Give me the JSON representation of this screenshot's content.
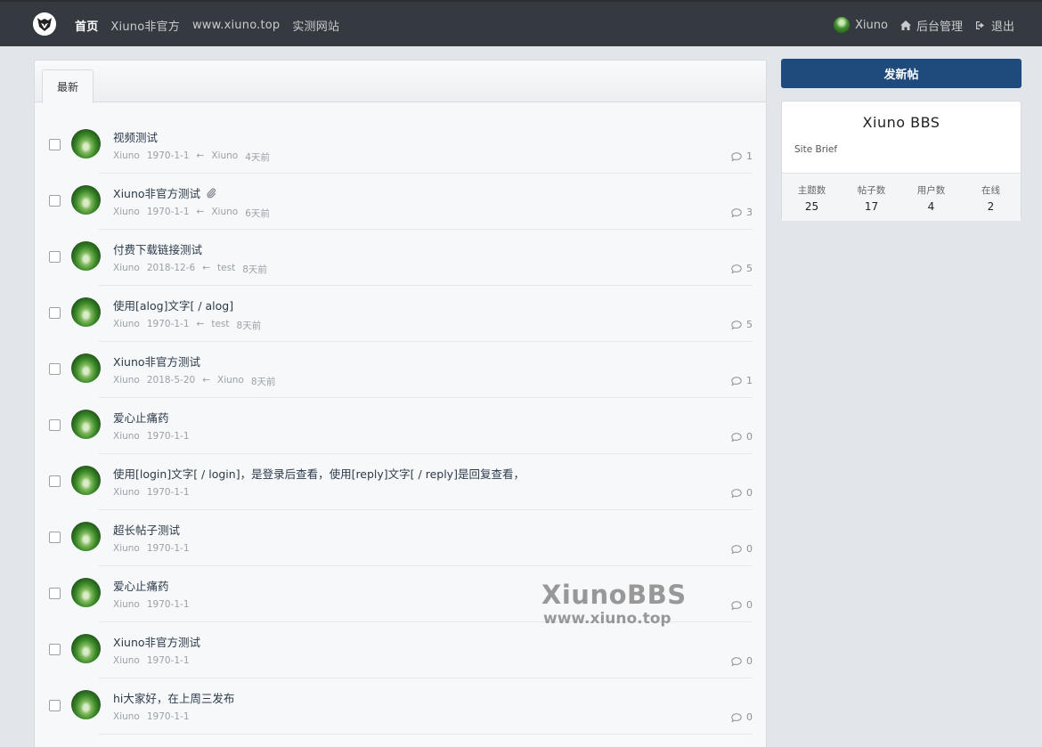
{
  "nav": {
    "links": [
      {
        "label": "首页"
      },
      {
        "label": "Xiuno非官方"
      },
      {
        "label": "www.xiuno.top"
      },
      {
        "label": "实测网站"
      }
    ],
    "user": "Xiuno",
    "admin": "后台管理",
    "logout": "退出",
    "icons": {
      "admin": "home-icon",
      "logout": "sign-out-icon"
    }
  },
  "tabs": [
    {
      "label": "最新"
    }
  ],
  "threads": [
    {
      "title": "视频测试",
      "author": "Xiuno",
      "date": "1970-1-1",
      "last_user": "Xiuno",
      "last_time": "4天前",
      "replies": "1",
      "attachment": false
    },
    {
      "title": "Xiuno非官方测试",
      "author": "Xiuno",
      "date": "1970-1-1",
      "last_user": "Xiuno",
      "last_time": "6天前",
      "replies": "3",
      "attachment": true
    },
    {
      "title": "付费下载链接测试",
      "author": "Xiuno",
      "date": "2018-12-6",
      "last_user": "test",
      "last_time": "8天前",
      "replies": "5",
      "attachment": false
    },
    {
      "title": "使用[alog]文字[ / alog]",
      "author": "Xiuno",
      "date": "1970-1-1",
      "last_user": "test",
      "last_time": "8天前",
      "replies": "5",
      "attachment": false
    },
    {
      "title": "Xiuno非官方测试",
      "author": "Xiuno",
      "date": "2018-5-20",
      "last_user": "Xiuno",
      "last_time": "8天前",
      "replies": "1",
      "attachment": false
    },
    {
      "title": "爱心止痛药",
      "author": "Xiuno",
      "date": "1970-1-1",
      "last_user": "",
      "last_time": "",
      "replies": "0",
      "attachment": false
    },
    {
      "title": "使用[login]文字[ / login]，是登录后查看，使用[reply]文字[ / reply]是回复查看，",
      "author": "Xiuno",
      "date": "1970-1-1",
      "last_user": "",
      "last_time": "",
      "replies": "0",
      "attachment": false
    },
    {
      "title": "超长帖子测试",
      "author": "Xiuno",
      "date": "1970-1-1",
      "last_user": "",
      "last_time": "",
      "replies": "0",
      "attachment": false
    },
    {
      "title": "爱心止痛药",
      "author": "Xiuno",
      "date": "1970-1-1",
      "last_user": "",
      "last_time": "",
      "replies": "0",
      "attachment": false
    },
    {
      "title": "Xiuno非官方测试",
      "author": "Xiuno",
      "date": "1970-1-1",
      "last_user": "",
      "last_time": "",
      "replies": "0",
      "attachment": false
    },
    {
      "title": "hi大家好，在上周三发布",
      "author": "Xiuno",
      "date": "1970-1-1",
      "last_user": "",
      "last_time": "",
      "replies": "0",
      "attachment": false
    }
  ],
  "sidebar": {
    "new_post": "发新帖",
    "site_name": "Xiuno BBS",
    "site_brief": "Site Brief",
    "stats": [
      {
        "label": "主题数",
        "value": "25"
      },
      {
        "label": "帖子数",
        "value": "17"
      },
      {
        "label": "用户数",
        "value": "4"
      },
      {
        "label": "在线",
        "value": "2"
      }
    ]
  },
  "watermark": {
    "line1": "XiunoBBS",
    "line2": "www.xiuno.top"
  },
  "colors": {
    "nav_bg": "#343a40",
    "primary": "#1f4a7c",
    "page_bg": "#e2e5ea"
  }
}
